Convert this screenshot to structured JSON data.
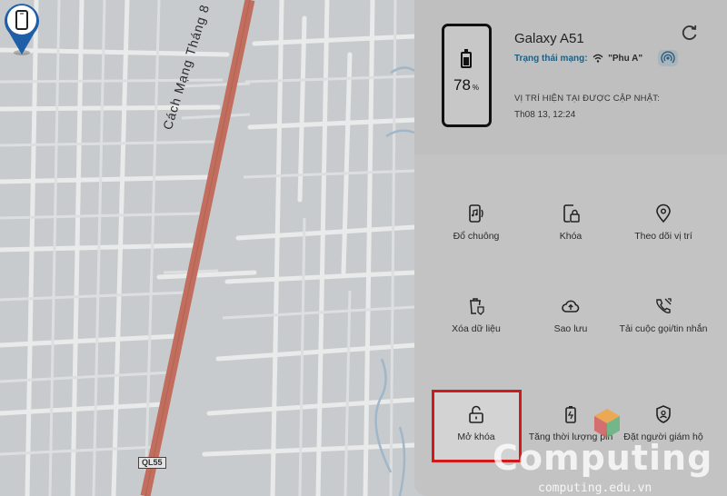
{
  "map": {
    "road_name": "Cách Mạng Tháng 8",
    "route_badge": "QL55"
  },
  "device": {
    "name": "Galaxy A51",
    "battery_percent": "78",
    "battery_unit": "%",
    "network_label": "Trạng thái mạng:",
    "network_name": "\"Phu A\"",
    "location_label": "VỊ TRÍ HIỆN TẠI ĐƯỢC CẬP NHẬT:",
    "location_time": "Th08 13, 12:24"
  },
  "actions": [
    {
      "label": "Đổ chuông",
      "icon": "ring-phone-icon"
    },
    {
      "label": "Khóa",
      "icon": "lock-phone-icon"
    },
    {
      "label": "Theo dõi vị trí",
      "icon": "location-pin-icon"
    },
    {
      "label": "Xóa dữ liệu",
      "icon": "erase-data-icon"
    },
    {
      "label": "Sao lưu",
      "icon": "cloud-backup-icon"
    },
    {
      "label": "Tải cuộc gọi/tin nhắn",
      "icon": "call-log-icon"
    },
    {
      "label": "Mở khóa",
      "icon": "unlock-icon"
    },
    {
      "label": "Tăng thời lượng pin",
      "icon": "battery-extend-icon"
    },
    {
      "label": "Đặt người giám hộ",
      "icon": "guardian-shield-icon"
    }
  ],
  "watermark": {
    "brand": "Computing",
    "domain": "computing.edu.vn"
  },
  "colors": {
    "highlight": "#d0191b",
    "pin": "#1e5fa8",
    "road": "#c26e5e",
    "network_label": "#1f5f83"
  }
}
